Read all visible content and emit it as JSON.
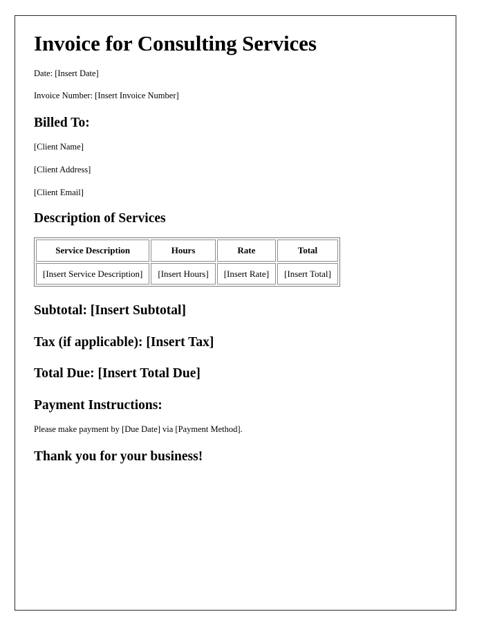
{
  "document": {
    "title": "Invoice for Consulting Services",
    "meta": [
      "Date: [Insert Date]",
      "Invoice Number: [Insert Invoice Number]"
    ],
    "billed_to": {
      "heading": "Billed To:",
      "lines": [
        "[Client Name]",
        "[Client Address]",
        "[Client Email]"
      ]
    },
    "services": {
      "heading": "Description of Services",
      "columns": [
        "Service Description",
        "Hours",
        "Rate",
        "Total"
      ],
      "rows": [
        [
          "[Insert Service Description]",
          "[Insert Hours]",
          "[Insert Rate]",
          "[Insert Total]"
        ]
      ]
    },
    "totals": [
      "Subtotal: [Insert Subtotal]",
      "Tax (if applicable): [Insert Tax]",
      "Total Due: [Insert Total Due]"
    ],
    "payment": {
      "heading": "Payment Instructions:",
      "note": "Please make payment by [Due Date] via [Payment Method]."
    },
    "closing": "Thank you for your business!"
  }
}
